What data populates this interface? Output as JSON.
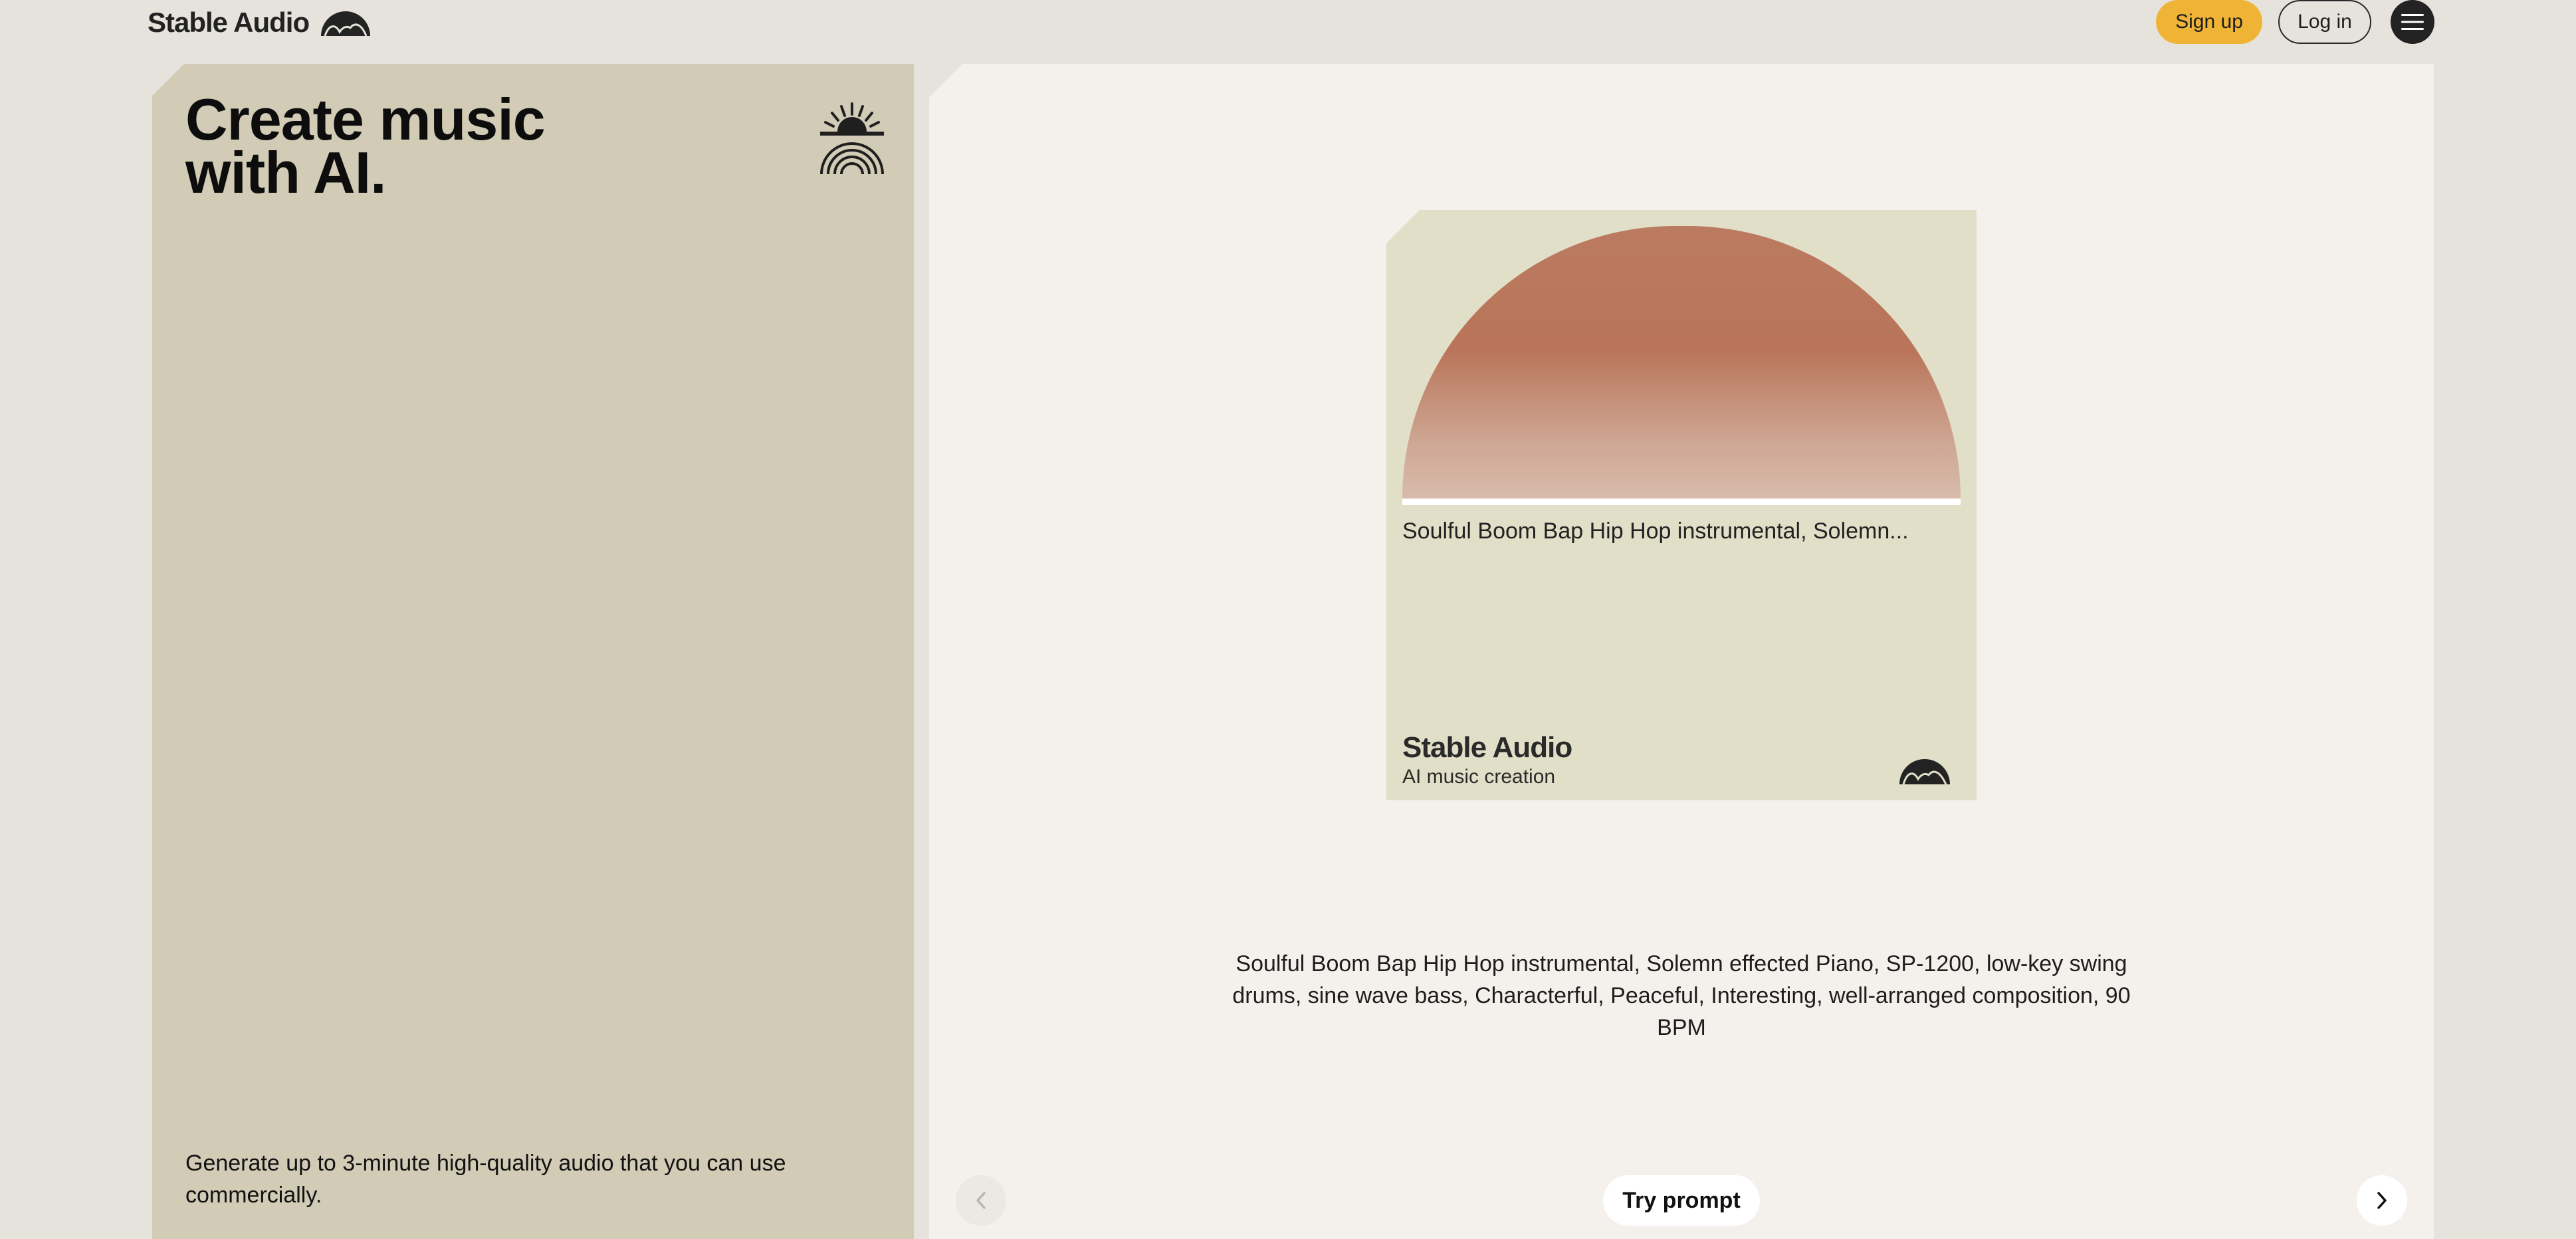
{
  "header": {
    "brand": "Stable Audio",
    "brand_icon": "stable-audio-logo-icon",
    "signup_label": "Sign up",
    "login_label": "Log in",
    "menu_icon": "hamburger-menu-icon",
    "accent_color": "#efb336"
  },
  "hero": {
    "headline_line1": "Create music",
    "headline_line2": "with AI.",
    "icon": "sun-rainbow-icon",
    "description": "Generate up to 3-minute high-quality audio that you can use commercially."
  },
  "player": {
    "track_title": "Soulful Boom Bap Hip Hop instrumental, Solemn...",
    "brand": "Stable Audio",
    "subtitle": "AI music creation",
    "brand_icon": "stable-audio-logo-icon",
    "prompt": "Soulful Boom Bap Hip Hop instrumental, Solemn effected Piano, SP-1200, low-key swing drums, sine wave bass, Characterful, Peaceful, Interesting, well-arranged composition, 90 BPM",
    "try_label": "Try prompt",
    "prev_icon": "chevron-left-icon",
    "next_icon": "chevron-right-icon"
  }
}
